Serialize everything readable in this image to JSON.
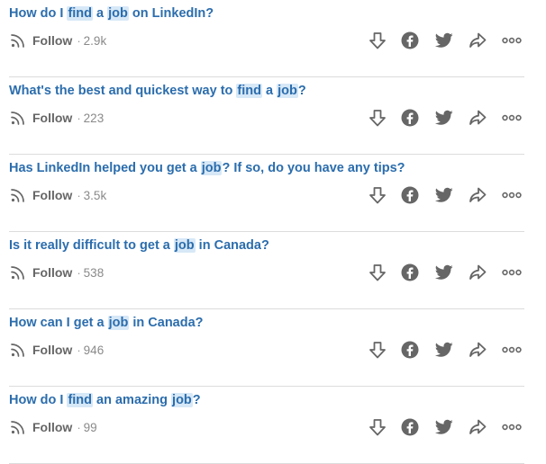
{
  "questions": [
    {
      "parts": [
        {
          "t": "How do I "
        },
        {
          "t": "find",
          "hl": true
        },
        {
          "t": " a "
        },
        {
          "t": "job",
          "hl": true
        },
        {
          "t": " on LinkedIn?"
        }
      ],
      "follow_label": "Follow",
      "separator": "·",
      "count": "2.9k"
    },
    {
      "parts": [
        {
          "t": "What's the best and quickest way to "
        },
        {
          "t": "find",
          "hl": true
        },
        {
          "t": " a "
        },
        {
          "t": "job",
          "hl": true
        },
        {
          "t": "?"
        }
      ],
      "follow_label": "Follow",
      "separator": "·",
      "count": "223"
    },
    {
      "parts": [
        {
          "t": "Has LinkedIn helped you get a "
        },
        {
          "t": "job",
          "hl": true
        },
        {
          "t": "? If so, do you have any tips?"
        }
      ],
      "follow_label": "Follow",
      "separator": "·",
      "count": "3.5k"
    },
    {
      "parts": [
        {
          "t": "Is it really difficult to get a "
        },
        {
          "t": "job",
          "hl": true
        },
        {
          "t": " in Canada?"
        }
      ],
      "follow_label": "Follow",
      "separator": "·",
      "count": "538"
    },
    {
      "parts": [
        {
          "t": "How can I get a "
        },
        {
          "t": "job",
          "hl": true
        },
        {
          "t": " in Canada?"
        }
      ],
      "follow_label": "Follow",
      "separator": "·",
      "count": "946"
    },
    {
      "parts": [
        {
          "t": "How do I "
        },
        {
          "t": "find",
          "hl": true
        },
        {
          "t": " an amazing "
        },
        {
          "t": "job",
          "hl": true
        },
        {
          "t": "?"
        }
      ],
      "follow_label": "Follow",
      "separator": "·",
      "count": "99"
    }
  ],
  "actions": [
    "downvote-icon",
    "facebook-icon",
    "twitter-icon",
    "share-icon",
    "more-options-icon"
  ],
  "colors": {
    "link": "#2b6dad",
    "highlight": "#d7e8f7",
    "icon": "#666666",
    "divider": "#dcdcdc",
    "muted": "#8a8a8a"
  }
}
